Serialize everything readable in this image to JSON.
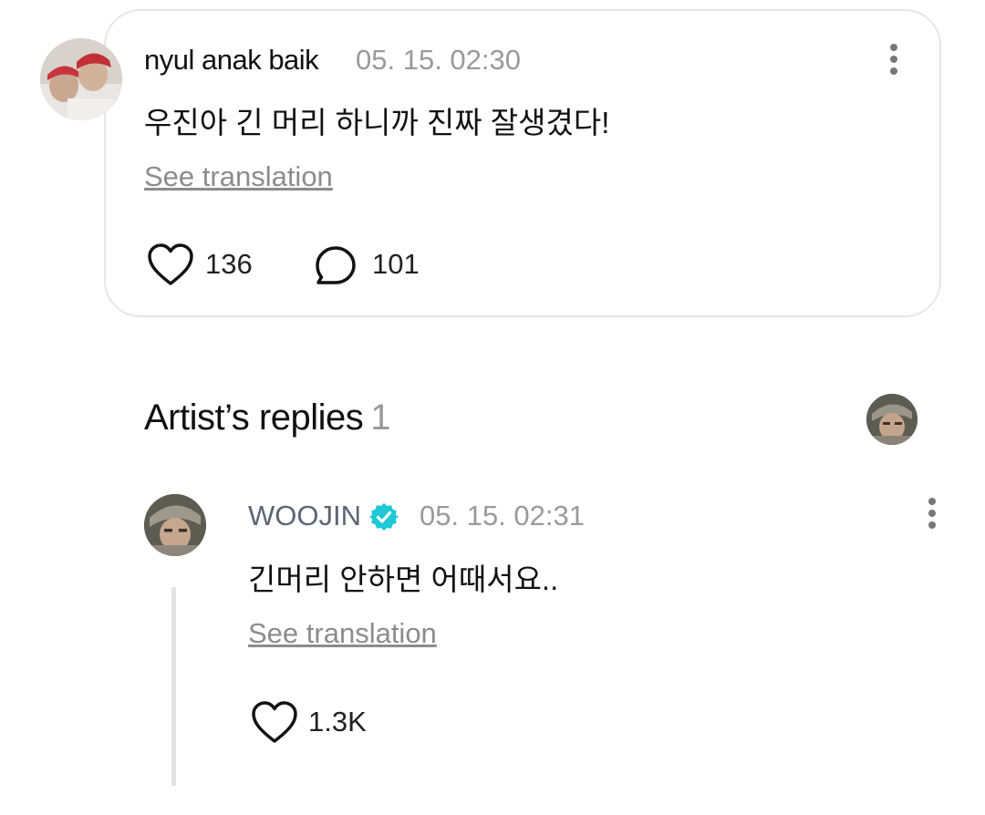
{
  "comment": {
    "author": "nyul anak baik",
    "timestamp": "05. 15. 02:30",
    "text": "우진아 긴 머리 하니까 진짜 잘생겼다!",
    "translate_label": "See translation",
    "likes": "136",
    "replies": "101"
  },
  "artist_replies": {
    "title": "Artist’s replies",
    "count": "1",
    "reply": {
      "author": "WOOJIN",
      "timestamp": "05. 15. 02:31",
      "text": "긴머리 안하면 어때서요..",
      "translate_label": "See translation",
      "likes": "1.3K"
    }
  },
  "icons": {
    "like": "heart-outline-icon",
    "reply": "speech-bubble-icon",
    "more": "more-vertical-icon",
    "verified": "verified-badge-icon"
  },
  "colors": {
    "verified_badge": "#1ec8d6",
    "artist_name": "#5a6675",
    "muted_text": "#9a9a9a",
    "card_border": "#e6e6e6"
  }
}
